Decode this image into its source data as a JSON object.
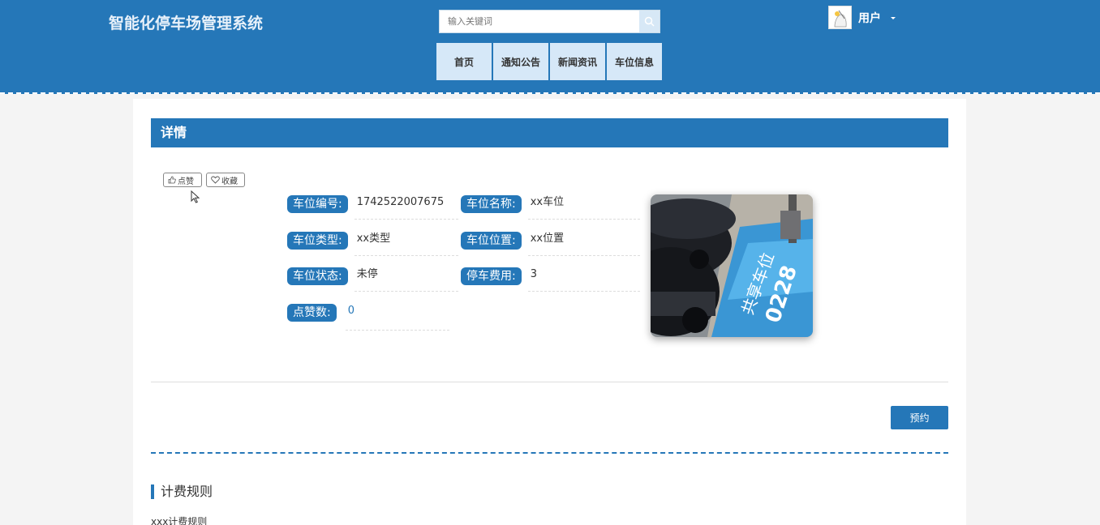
{
  "header": {
    "title": "智能化停车场管理系统",
    "search_placeholder": "输入关键词",
    "nav": [
      "首页",
      "通知公告",
      "新闻资讯",
      "车位信息"
    ],
    "user_name": "用户"
  },
  "detail": {
    "section_title": "详情",
    "like_label": "点赞",
    "favorite_label": "收藏",
    "fields": {
      "space_no_label": "车位编号:",
      "space_no_value": "1742522007675",
      "space_name_label": "车位名称:",
      "space_name_value": "xx车位",
      "space_type_label": "车位类型:",
      "space_type_value": "xx类型",
      "space_location_label": "车位位置:",
      "space_location_value": "xx位置",
      "space_status_label": "车位状态:",
      "space_status_value": "未停",
      "fee_label": "停车费用:",
      "fee_value": "3",
      "likes_label": "点赞数:",
      "likes_value": "0"
    },
    "reserve_button": "预约"
  },
  "rules": {
    "title": "计费规则",
    "content": "xxx计费规则"
  },
  "colors": {
    "primary": "#2577b8",
    "nav_bg": "#d6e8f8",
    "page_bg": "#f4f4f4"
  }
}
